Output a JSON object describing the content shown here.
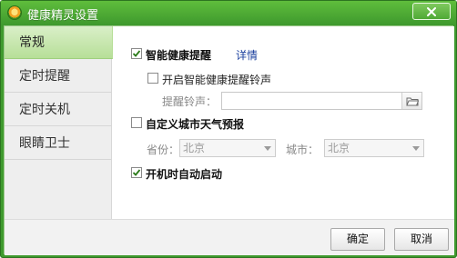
{
  "window": {
    "title": "健康精灵设置",
    "close_icon": "close-icon"
  },
  "sidebar": {
    "items": [
      {
        "label": "常规",
        "active": true
      },
      {
        "label": "定时提醒",
        "active": false
      },
      {
        "label": "定时关机",
        "active": false
      },
      {
        "label": "眼睛卫士",
        "active": false
      }
    ]
  },
  "general": {
    "health_reminder": {
      "label": "智能健康提醒",
      "checked": true,
      "details_link": "详情"
    },
    "reminder_sound": {
      "label": "开启智能健康提醒铃声",
      "checked": false
    },
    "sound_field": {
      "label": "提醒铃声：",
      "value": "",
      "browse_icon": "folder-icon"
    },
    "weather": {
      "label": "自定义城市天气预报",
      "checked": false
    },
    "province": {
      "label": "省份：",
      "value": "北京"
    },
    "city": {
      "label": "城市：",
      "value": "北京"
    },
    "autostart": {
      "label": "开机时自动启动",
      "checked": true
    }
  },
  "footer": {
    "ok_label": "确定",
    "cancel_label": "取消"
  },
  "colors": {
    "title_bar": "#3f9a2e",
    "sidebar_active": "#b7df98",
    "link": "#1a3f9e"
  }
}
